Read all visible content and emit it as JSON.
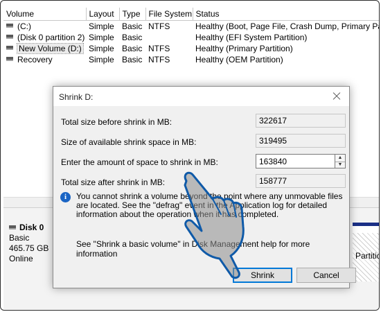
{
  "table": {
    "headers": [
      "Volume",
      "Layout",
      "Type",
      "File System",
      "Status"
    ],
    "rows": [
      {
        "volume": "(C:)",
        "layout": "Simple",
        "type": "Basic",
        "fs": "NTFS",
        "status": "Healthy (Boot, Page File, Crash Dump, Primary Partition)"
      },
      {
        "volume": "(Disk 0 partition 2)",
        "layout": "Simple",
        "type": "Basic",
        "fs": "",
        "status": "Healthy (EFI System Partition)"
      },
      {
        "volume": "New Volume (D:)",
        "layout": "Simple",
        "type": "Basic",
        "fs": "NTFS",
        "status": "Healthy (Primary Partition)"
      },
      {
        "volume": "Recovery",
        "layout": "Simple",
        "type": "Basic",
        "fs": "NTFS",
        "status": "Healthy (OEM Partition)"
      }
    ]
  },
  "disk": {
    "name": "Disk 0",
    "type": "Basic",
    "size": "465.75 GB",
    "state": "Online",
    "partition_text": "Partition)"
  },
  "dialog": {
    "title": "Shrink D:",
    "total_before_label": "Total size before shrink in MB:",
    "total_before_value": "322617",
    "available_label": "Size of available shrink space in MB:",
    "available_value": "319495",
    "amount_label": "Enter the amount of space to shrink in MB:",
    "amount_value": "163840",
    "total_after_label": "Total size after shrink in MB:",
    "total_after_value": "158777",
    "info_text": "You cannot shrink a volume beyond the point where any unmovable files are located. See the \"defrag\" event in the Application log for detailed information about the operation when it has completed.",
    "help_text": "See \"Shrink a basic volume\" in Disk Management help for more information",
    "shrink_label": "Shrink",
    "cancel_label": "Cancel"
  },
  "colors": {
    "accent": "#0078d7",
    "disk_bar": "#1a2f86",
    "info_icon": "#1a64c4"
  }
}
